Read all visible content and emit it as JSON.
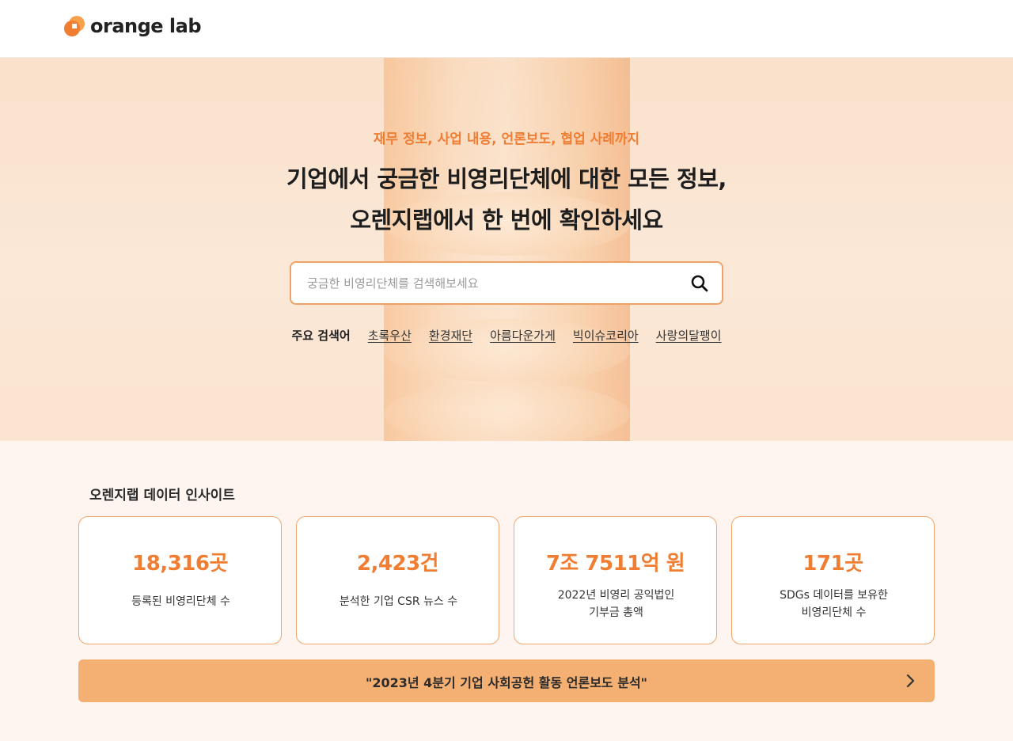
{
  "header": {
    "logo_text": "orange lab",
    "logo_icon": "orange-lab-logo-icon"
  },
  "hero": {
    "eyebrow": "재무 정보, 사업 내용, 언론보도, 협업 사례까지",
    "title_line1": "기업에서 궁금한 비영리단체에 대한 모든 정보,",
    "title_line2": "오렌지랩에서 한 번에 확인하세요",
    "search": {
      "placeholder": "궁금한 비영리단체를 검색해보세요",
      "value": "",
      "icon": "search-icon"
    },
    "keywords_label": "주요 검색어",
    "keywords": [
      "초록우산",
      "환경재단",
      "아름다운가게",
      "빅이슈코리아",
      "사랑의달팽이"
    ]
  },
  "insight": {
    "title": "오렌지랩 데이터 인사이트",
    "cards": [
      {
        "value": "18,316곳",
        "desc_line1": "등록된 비영리단체 수",
        "desc_line2": ""
      },
      {
        "value": "2,423건",
        "desc_line1": "분석한 기업 CSR 뉴스 수",
        "desc_line2": ""
      },
      {
        "value": "7조 7511억 원",
        "desc_line1": "2022년 비영리 공익법인",
        "desc_line2": "기부금 총액"
      },
      {
        "value": "171곳",
        "desc_line1": "SDGs 데이터를 보유한",
        "desc_line2": "비영리단체 수"
      }
    ],
    "banner_text": "\"2023년 4분기 기업 사회공헌 활동 언론보도 분석\"",
    "banner_icon": "chevron-right-icon"
  },
  "colors": {
    "accent": "#ef7d32",
    "banner": "#f4b072",
    "card_border": "#f2a56c",
    "section_bg": "#fef5f0"
  }
}
